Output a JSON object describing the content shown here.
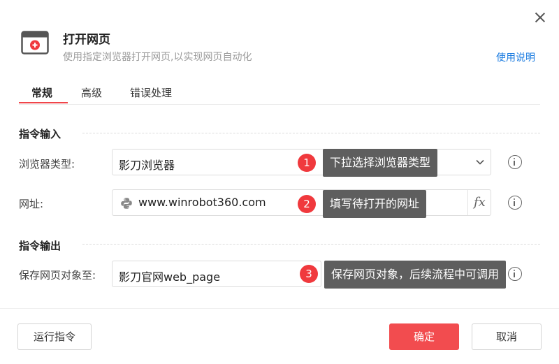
{
  "dialog": {
    "title": "打开网页",
    "subtitle": "使用指定浏览器打开网页,以实现网页自动化",
    "help_link": "使用说明",
    "close_icon": "close-icon",
    "app_icon": "browser-window-icon"
  },
  "tabs": [
    {
      "label": "常规",
      "active": true
    },
    {
      "label": "高级",
      "active": false
    },
    {
      "label": "错误处理",
      "active": false
    }
  ],
  "sections": {
    "input_title": "指令输入",
    "output_title": "指令输出"
  },
  "fields": {
    "browser_type": {
      "label": "浏览器类型:",
      "value": "影刀浏览器"
    },
    "url": {
      "label": "网址:",
      "value": "www.winrobot360.com",
      "fx_label": "fx"
    },
    "save_object": {
      "label": "保存网页对象至:",
      "value": "影刀官网web_page"
    }
  },
  "annotations": [
    {
      "number": "1",
      "text": "下拉选择浏览器类型"
    },
    {
      "number": "2",
      "text": "填写待打开的网址"
    },
    {
      "number": "3",
      "text": "保存网页对象，后续流程中可调用"
    }
  ],
  "footer": {
    "run_button": "运行指令",
    "confirm_button": "确定",
    "cancel_button": "取消"
  },
  "colors": {
    "accent": "#f24c4f",
    "link": "#1a7be0",
    "tooltip_bg": "#5e5e5e",
    "badge": "#f0393d"
  }
}
